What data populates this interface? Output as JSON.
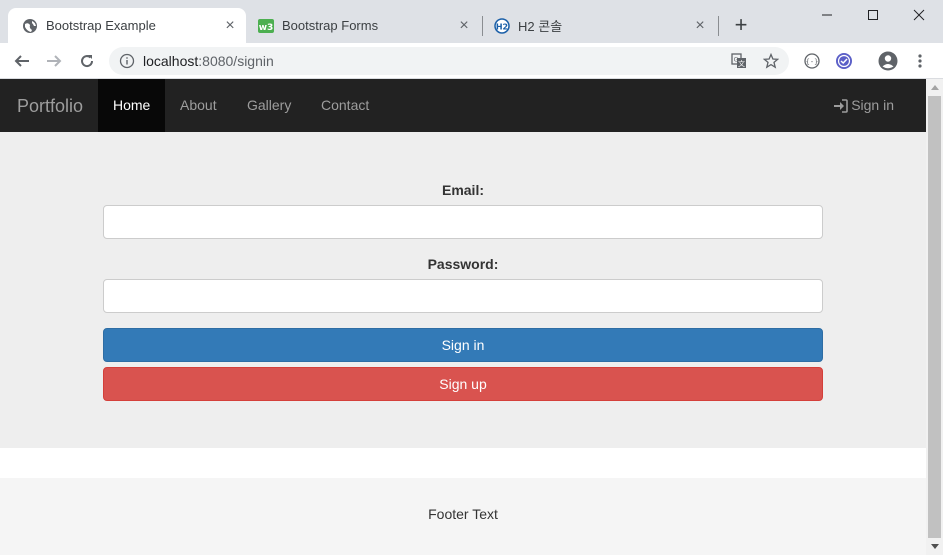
{
  "browser": {
    "tabs": [
      {
        "title": "Bootstrap Example",
        "icon": "globe-icon",
        "active": true
      },
      {
        "title": "Bootstrap Forms",
        "icon": "w3schools-icon",
        "active": false
      },
      {
        "title": "H2 콘솔",
        "icon": "h2-icon",
        "active": false
      }
    ],
    "new_tab_label": "+",
    "close_glyph": "×",
    "url": {
      "host": "localhost",
      "rest": ":8080/signin"
    }
  },
  "navbar": {
    "brand": "Portfolio",
    "links": [
      "Home",
      "About",
      "Gallery",
      "Contact"
    ],
    "active_link": "Home",
    "signin": "Sign in"
  },
  "form": {
    "email_label": "Email:",
    "email_value": "",
    "password_label": "Password:",
    "password_value": "",
    "signin_button": "Sign in",
    "signup_button": "Sign up"
  },
  "footer": {
    "text": "Footer Text"
  },
  "colors": {
    "navbar_bg": "#222222",
    "primary": "#337ab7",
    "danger": "#d9534f",
    "jumbotron_bg": "#eeeeee"
  }
}
